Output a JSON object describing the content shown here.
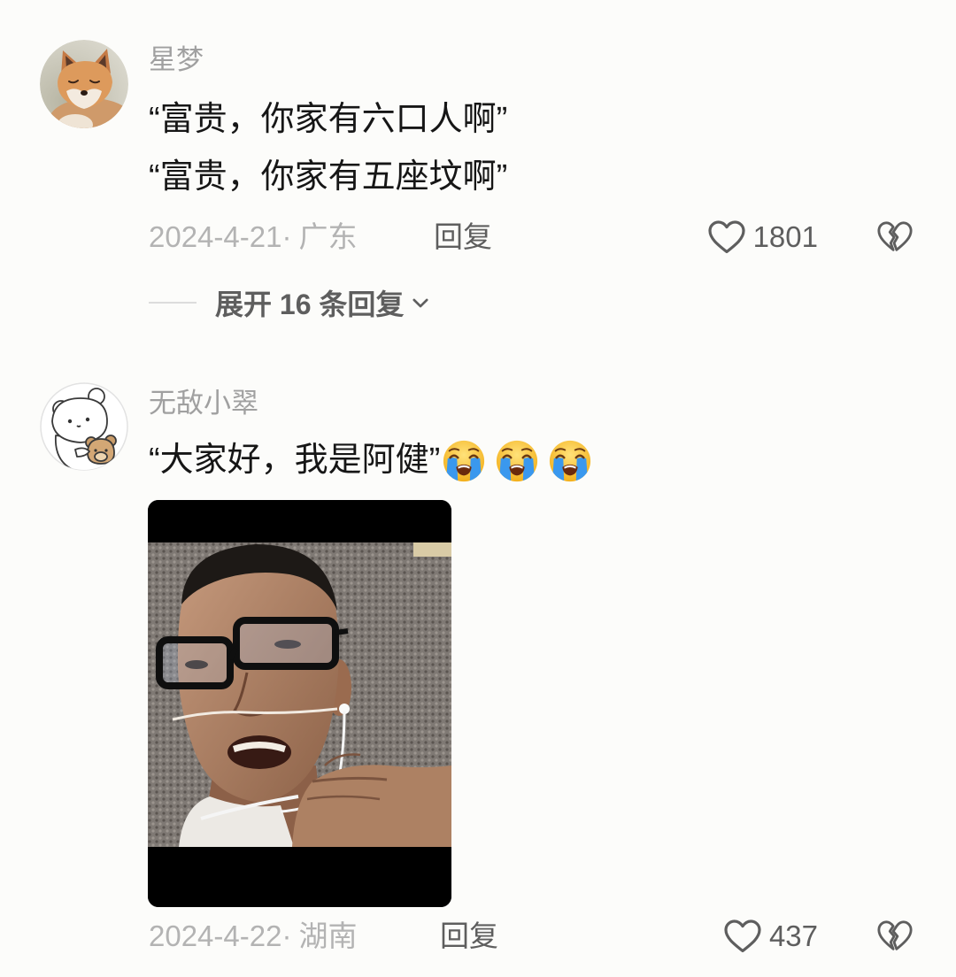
{
  "colors": {
    "background": "#fcfcfa",
    "text": "#161616",
    "username": "#a0a0a0",
    "meta": "#b3b3b3",
    "action": "#5e5e5e"
  },
  "meta_separator": "·",
  "comments": [
    {
      "username": "星梦",
      "avatar_icon": "fox-avatar",
      "lines": [
        "“富贵，你家有六口人啊”",
        "“富贵，你家有五座坟啊”"
      ],
      "date": "2024-4-21",
      "location": "广东",
      "reply_label": "回复",
      "like_icon": "heart-outline-icon",
      "like_count": "1801",
      "dislike_icon": "broken-heart-icon",
      "expand_replies_label": "展开 16 条回复",
      "expand_icon": "chevron-down-icon"
    },
    {
      "username": "无敌小翠",
      "avatar_icon": "cartoon-bear-avatar",
      "lines": [
        "“大家好，我是阿健”"
      ],
      "emojis": [
        "loudly-crying-face-icon",
        "loudly-crying-face-icon",
        "loudly-crying-face-icon"
      ],
      "image_attachment": true,
      "date": "2024-4-22",
      "location": "湖南",
      "reply_label": "回复",
      "like_icon": "heart-outline-icon",
      "like_count": "437",
      "dislike_icon": "broken-heart-icon"
    }
  ]
}
